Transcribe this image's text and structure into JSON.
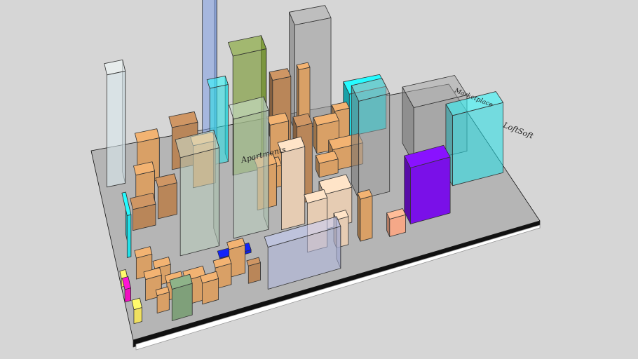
{
  "scene": {
    "kind": "3D city block model",
    "labels": {
      "tower_label": "Apartments",
      "box_label": "LoftSoft",
      "cyan_label": "Marketplace"
    }
  },
  "colors": {
    "background": "#d6d6d6",
    "tan": "#d9a066",
    "brown": "#b98659",
    "beige": "#e6ccb3",
    "glass_white": "#dcecf2",
    "glass_blue": "#7f9fe6",
    "glass_green": "#6b8f1a",
    "glass_grey": "#9a9a9a",
    "glass_sage": "#b8ccbc",
    "glass_lilac": "#b0b8e0",
    "cyan": "#22e0e8",
    "purple": "#7a10e8",
    "blue": "#1020e0",
    "magenta": "#f010c0",
    "yellow": "#f0e060",
    "green_box": "#7fa07a",
    "salmon": "#f5a888"
  }
}
